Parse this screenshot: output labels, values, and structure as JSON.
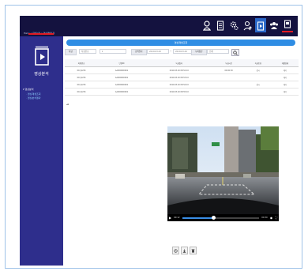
{
  "header": {
    "breadcrumb": "Home > 영상분석 > 영상재생조회"
  },
  "topnav": {
    "items": [
      {
        "icon": "user-pin-icon"
      },
      {
        "icon": "document-list-icon"
      },
      {
        "icon": "settings-gears-icon"
      },
      {
        "icon": "user-settings-icon"
      },
      {
        "icon": "video-analysis-icon",
        "active": true
      },
      {
        "icon": "users-group-icon"
      },
      {
        "icon": "logout-icon"
      }
    ]
  },
  "sidebar": {
    "title": "영상분석",
    "tree": [
      {
        "label": "영상분석",
        "child": false
      },
      {
        "label": "영상재생조회",
        "child": true
      },
      {
        "label": "영상분석결과",
        "child": true
      }
    ]
  },
  "panel": {
    "title": "영상재생조회"
  },
  "filters": {
    "vehicle_label": "차량",
    "vehicle_value": "차량번호",
    "date_label": "검색일자",
    "date_from": "2019.03.20",
    "date_sep": "~",
    "date_to": "2019.03.20",
    "type_label": "녹화종류",
    "type_value": "전체"
  },
  "table": {
    "headers": [
      "차량번호",
      "단말ID",
      "녹화일자",
      "녹화시간",
      "녹화종류",
      "재생상태"
    ],
    "rows": [
      [
        "00가1234",
        "AA000000001",
        "2019.03.20 08:52:10",
        "00:00:30",
        "상시",
        "대기"
      ],
      [
        "00가1234",
        "AA000000001",
        "2019.03.20 08:53:10",
        "",
        "",
        "대기"
      ],
      [
        "00가1234",
        "AA000000001",
        "2019.03.20 08:54:10",
        "",
        "상시",
        "대기"
      ],
      [
        "00가1234",
        "AA000000001",
        "2019.03.20 08:55:10",
        "",
        "",
        "대기"
      ]
    ]
  },
  "pager": "1",
  "video": {
    "current_time": "00:12",
    "duration": "00:30",
    "progress": 0.4
  },
  "colors": {
    "topbar": "#14123f",
    "sidebar": "#2e2e8c",
    "accent": "#2f8de4",
    "active_nav": "#2a67c8",
    "brand_red": "#e21b23"
  }
}
